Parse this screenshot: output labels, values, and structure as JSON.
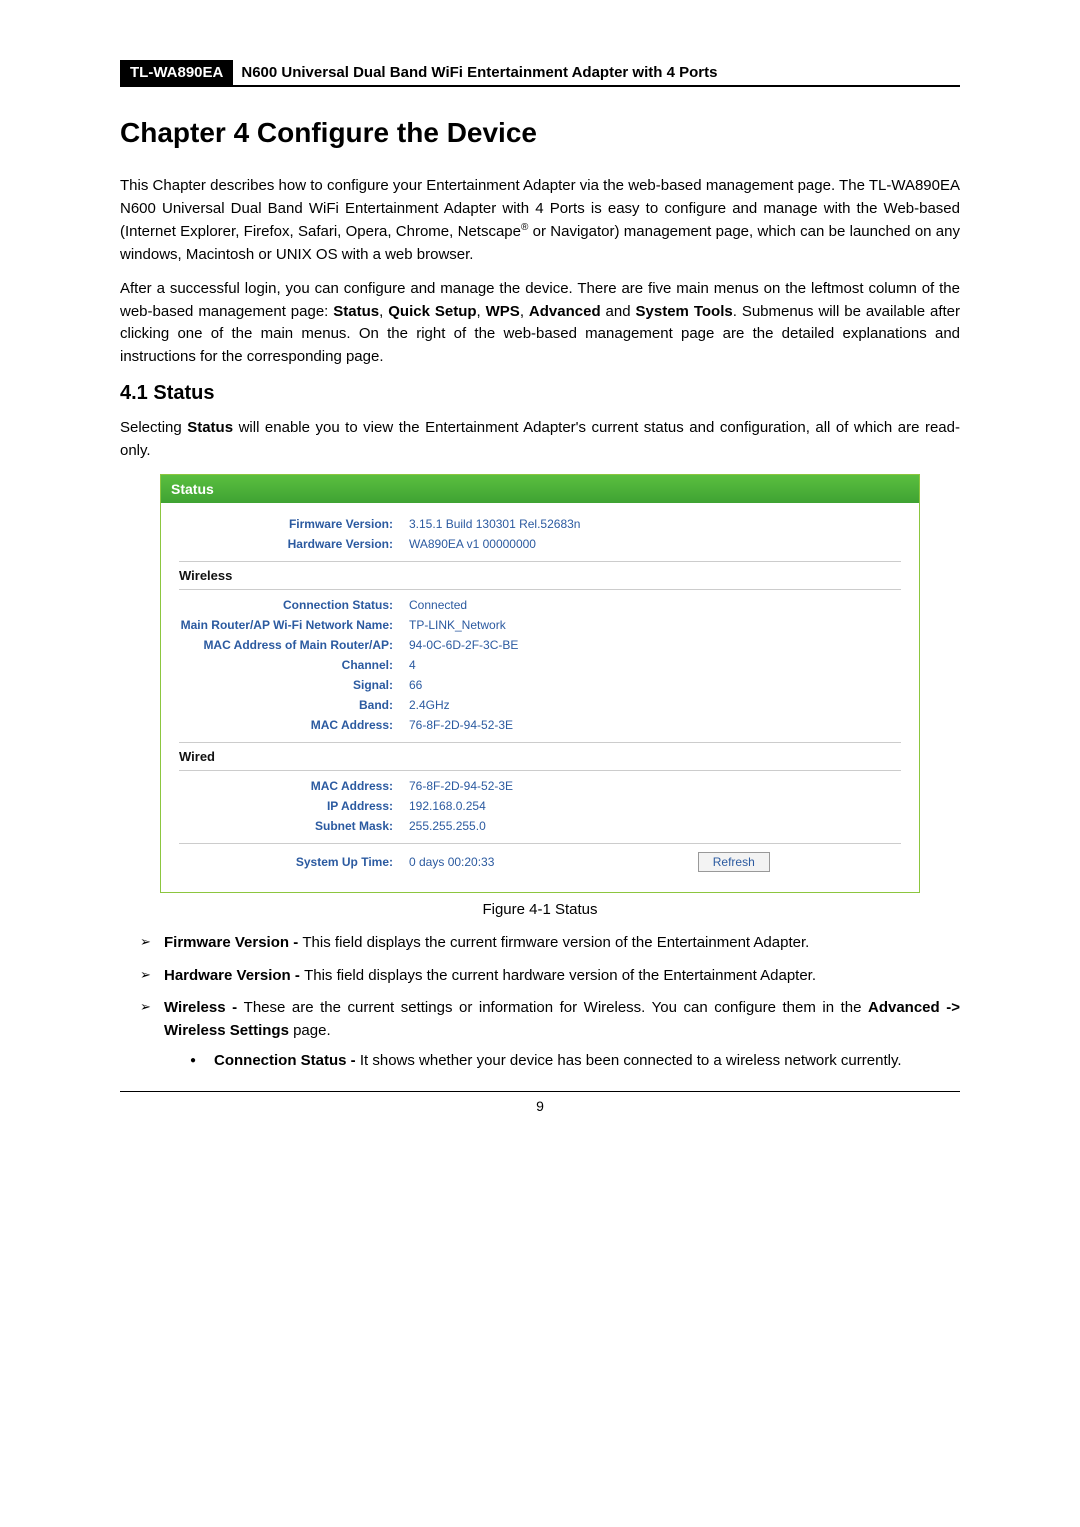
{
  "header": {
    "model": "TL-WA890EA",
    "title": "N600 Universal Dual Band WiFi Entertainment Adapter with 4 Ports"
  },
  "chapter": {
    "title": "Chapter 4  Configure the Device",
    "para1a": "This Chapter describes how to configure your Entertainment Adapter via the web-based management page. The TL-WA890EA N600 Universal Dual Band WiFi Entertainment Adapter with 4 Ports is easy to configure and manage with the Web-based (Internet Explorer, Firefox, Safari, Opera, Chrome, Netscape",
    "para1b": " or Navigator) management page, which can be launched on any windows, Macintosh or UNIX OS with a web browser.",
    "para2": "After a successful login, you can configure and manage the device. There are five main menus on the leftmost column of the web-based management page: Status, Quick Setup, WPS, Advanced and System Tools. Submenus will be available after clicking one of the main menus. On the right of the web-based management page are the detailed explanations and instructions for the corresponding page."
  },
  "section": {
    "title": "4.1   Status",
    "intro": "Selecting Status will enable you to view the Entertainment Adapter's current status and configuration, all of which are read-only."
  },
  "panel": {
    "title": "Status",
    "firmware_label": "Firmware Version:",
    "firmware_value": "3.15.1 Build 130301 Rel.52683n",
    "hardware_label": "Hardware Version:",
    "hardware_value": "WA890EA v1 00000000",
    "wireless_head": "Wireless",
    "conn_label": "Connection Status:",
    "conn_value": "Connected",
    "mainap_label": "Main Router/AP Wi-Fi Network Name:",
    "mainap_value": "TP-LINK_Network",
    "macap_label": "MAC Address of Main Router/AP:",
    "macap_value": "94-0C-6D-2F-3C-BE",
    "chan_label": "Channel:",
    "chan_value": "4",
    "signal_label": "Signal:",
    "signal_value": "66",
    "band_label": "Band:",
    "band_value": "2.4GHz",
    "mac_label": "MAC Address:",
    "mac_value": "76-8F-2D-94-52-3E",
    "wired_head": "Wired",
    "wmac_label": "MAC Address:",
    "wmac_value": "76-8F-2D-94-52-3E",
    "ip_label": "IP Address:",
    "ip_value": "192.168.0.254",
    "mask_label": "Subnet Mask:",
    "mask_value": "255.255.255.0",
    "uptime_label": "System Up Time:",
    "uptime_value": "0 days 00:20:33",
    "refresh": "Refresh"
  },
  "figure_caption": "Figure 4-1 Status",
  "list": {
    "item1_strong": "Firmware Version - ",
    "item1_rest": "This field displays the current firmware version of the Entertainment Adapter.",
    "item2_strong": "Hardware Version - ",
    "item2_rest": "This field displays the current hardware version of the Entertainment Adapter.",
    "item3_strong": "Wireless - ",
    "item3_rest": "These are the current settings or information for Wireless. You can configure them in the ",
    "item3_strong2": "Advanced -> Wireless Settings",
    "item3_rest2": " page.",
    "sub1_strong": "Connection Status - ",
    "sub1_rest": "It shows whether your device has been connected to a wireless network currently."
  },
  "page_number": "9"
}
